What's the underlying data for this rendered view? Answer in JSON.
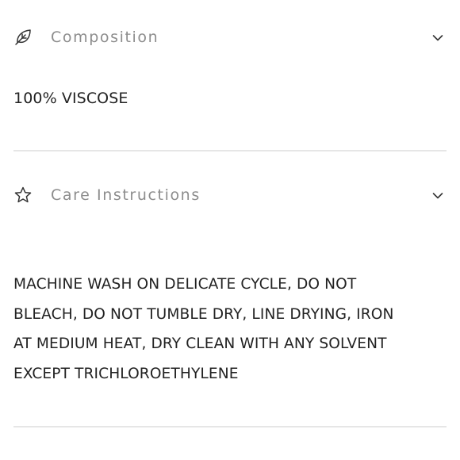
{
  "sections": [
    {
      "title": "Composition",
      "icon": "leaf-icon",
      "expanded": true,
      "content": "100% VISCOSE"
    },
    {
      "title": "Care Instructions",
      "icon": "star-icon",
      "expanded": true,
      "content_lines": [
        "MACHINE WASH ON DELICATE CYCLE, DO NOT",
        "BLEACH, DO NOT TUMBLE DRY, LINE DRYING, IRON",
        "AT MEDIUM HEAT, DRY CLEAN WITH ANY SOLVENT",
        "EXCEPT TRICHLOROETHYLENE"
      ]
    }
  ],
  "colors": {
    "title": "#8d8d8d",
    "text": "#222222",
    "divider": "#e6e6e6"
  }
}
